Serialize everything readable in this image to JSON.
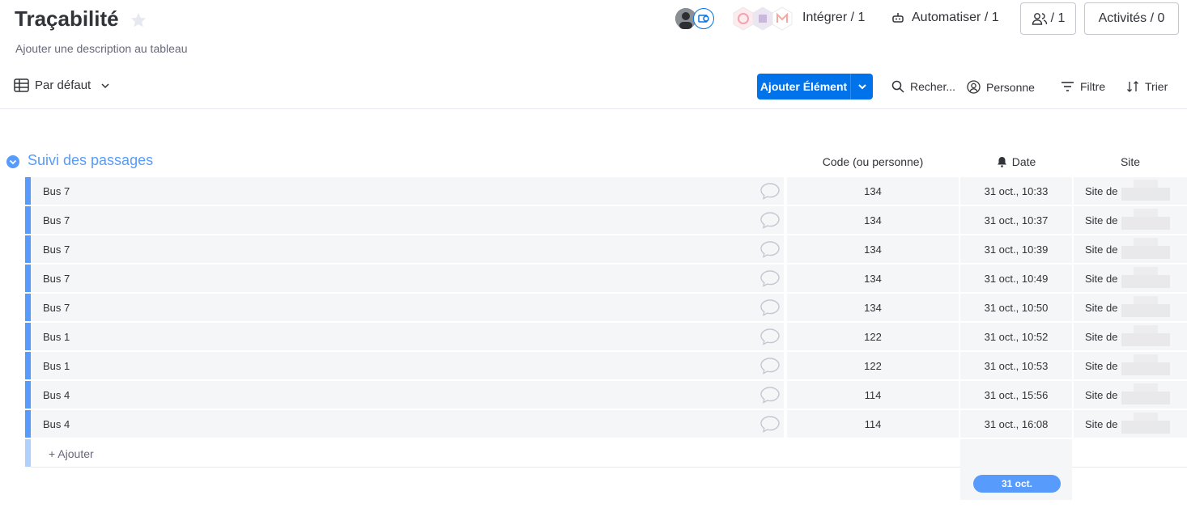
{
  "board": {
    "title": "Traçabilité",
    "description": "Ajouter une description au tableau"
  },
  "top_bar": {
    "integrate_label": "Intégrer / 1",
    "automate_label": "Automatiser / 1",
    "members_label": "/ 1",
    "activity_label": "Activités / 0"
  },
  "toolbar": {
    "view_label": "Par défaut",
    "add_item_label": "Ajouter Élément",
    "search_label": "Recher...",
    "person_label": "Personne",
    "filter_label": "Filtre",
    "sort_label": "Trier"
  },
  "group": {
    "title": "Suivi des passages",
    "color": "#579bfc",
    "columns": {
      "code": "Code (ou personne)",
      "date": "Date",
      "site": "Site"
    },
    "rows": [
      {
        "name": "Bus 7",
        "code": "134",
        "date": "31 oct., 10:33",
        "site": "Site de"
      },
      {
        "name": "Bus 7",
        "code": "134",
        "date": "31 oct., 10:37",
        "site": "Site de"
      },
      {
        "name": "Bus 7",
        "code": "134",
        "date": "31 oct., 10:39",
        "site": "Site de"
      },
      {
        "name": "Bus 7",
        "code": "134",
        "date": "31 oct., 10:49",
        "site": "Site de"
      },
      {
        "name": "Bus 7",
        "code": "134",
        "date": "31 oct., 10:50",
        "site": "Site de"
      },
      {
        "name": "Bus 1",
        "code": "122",
        "date": "31 oct., 10:52",
        "site": "Site de"
      },
      {
        "name": "Bus 1",
        "code": "122",
        "date": "31 oct., 10:53",
        "site": "Site de"
      },
      {
        "name": "Bus 4",
        "code": "114",
        "date": "31 oct., 15:56",
        "site": "Site de"
      },
      {
        "name": "Bus 4",
        "code": "114",
        "date": "31 oct., 16:08",
        "site": "Site de"
      }
    ],
    "add_label": "+ Ajouter",
    "date_summary": "31 oct."
  }
}
